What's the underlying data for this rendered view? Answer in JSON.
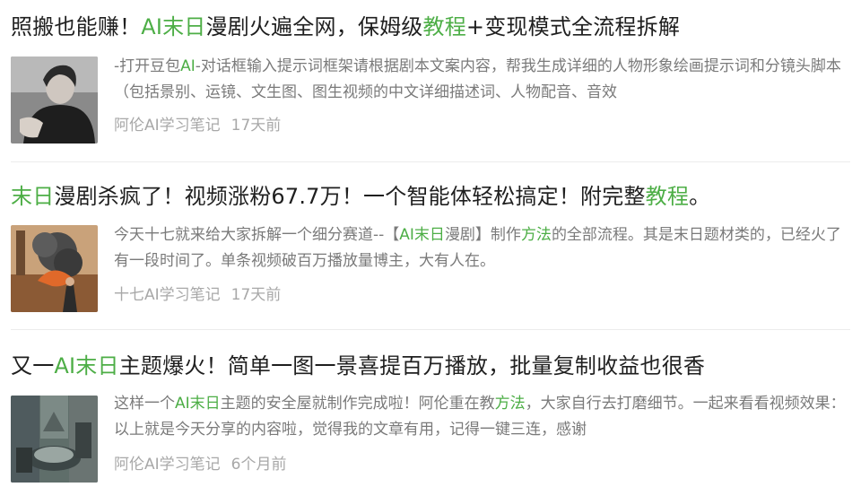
{
  "accent_color": "#4dae46",
  "results": [
    {
      "title_parts": [
        {
          "text": "照搬也能赚！",
          "hl": false
        },
        {
          "text": "AI末日",
          "hl": true
        },
        {
          "text": "漫剧火遍全网，保姆级",
          "hl": false
        },
        {
          "text": "教程",
          "hl": true
        },
        {
          "text": "+变现模式全流程拆解",
          "hl": false
        }
      ],
      "desc_parts": [
        {
          "text": "-打开豆包",
          "hl": false
        },
        {
          "text": "AI",
          "hl": true
        },
        {
          "text": "-对话框输入提示词框架请根据剧本文案内容，帮我生成详细的人物形象绘画提示词和分镜头脚本（包括景别、运镜、文生图、图生视频的中文详细描述词、人物配音、音效",
          "hl": false
        }
      ],
      "author": "阿伦AI学习笔记",
      "time": "17天前",
      "thumbnail": "portrait-photo"
    },
    {
      "title_parts": [
        {
          "text": "末日",
          "hl": true
        },
        {
          "text": "漫剧杀疯了！视频涨粉67.7万！一个智能体轻松搞定！附完整",
          "hl": false
        },
        {
          "text": "教程",
          "hl": true
        },
        {
          "text": "。",
          "hl": false
        }
      ],
      "desc_parts": [
        {
          "text": "今天十七就来给大家拆解一个细分赛道--【",
          "hl": false
        },
        {
          "text": "AI末日",
          "hl": true
        },
        {
          "text": "漫剧】制作",
          "hl": false
        },
        {
          "text": "方法",
          "hl": true
        },
        {
          "text": "的全部流程。其是末日题材类的，已经火了有一段时间了。单条视频破百万播放量博主，大有人在。",
          "hl": false
        }
      ],
      "author": "十七AI学习笔记",
      "time": "17天前",
      "thumbnail": "apocalypse-explosion"
    },
    {
      "title_parts": [
        {
          "text": "又一",
          "hl": false
        },
        {
          "text": "AI末日",
          "hl": true
        },
        {
          "text": "主题爆火！简单一图一景喜提百万播放，批量复制收益也很香",
          "hl": false
        }
      ],
      "desc_parts": [
        {
          "text": "这样一个",
          "hl": false
        },
        {
          "text": "AI末日",
          "hl": true
        },
        {
          "text": "主题的安全屋就制作完成啦！阿伦重在教",
          "hl": false
        },
        {
          "text": "方法",
          "hl": true
        },
        {
          "text": "，大家自行去打磨细节。一起来看看视频效果：以上就是今天分享的内容啦，觉得我的文章有用，记得一键三连，感谢",
          "hl": false
        }
      ],
      "author": "阿伦AI学习笔记",
      "time": "6个月前",
      "thumbnail": "safe-house-collage"
    }
  ]
}
